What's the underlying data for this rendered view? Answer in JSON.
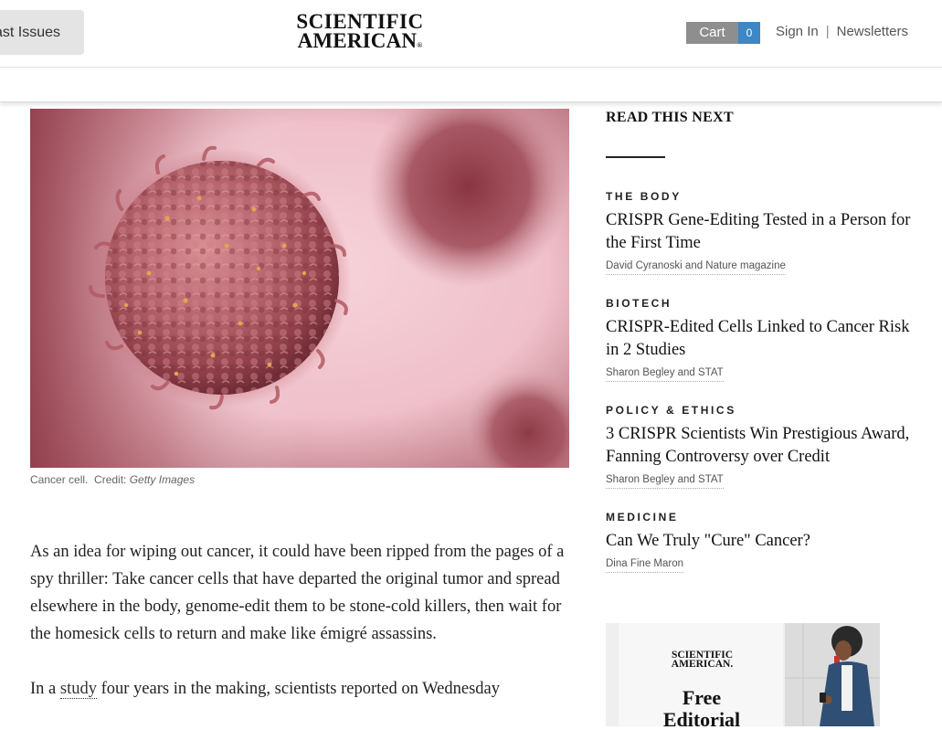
{
  "header": {
    "past_issues_label": "Past Issues",
    "logo_line1": "SCIENTIFIC",
    "logo_line2": "AMERICAN",
    "logo_mark": "®",
    "cart_label": "Cart",
    "cart_count": "0",
    "sign_in": "Sign In",
    "separator": "|",
    "newsletters": "Newsletters"
  },
  "article": {
    "image_caption": "Cancer cell.",
    "image_credit_label": "Credit:",
    "image_credit": "Getty Images",
    "paragraph1": "As an idea for wiping out cancer, it could have been ripped from the pages of a spy thriller: Take cancer cells that have departed the original tumor and spread elsewhere in the body, genome-edit them to be stone-cold killers, then wait for the homesick cells to return and make like émigré assassins.",
    "paragraph2_prefix": "In a",
    "paragraph2_link": "study",
    "paragraph2_rest": "four years in the making, scientists reported on Wednesday"
  },
  "sidebar": {
    "heading": "READ THIS NEXT",
    "items": [
      {
        "category": "THE BODY",
        "title": "CRISPR Gene-Editing Tested in a Person for the First Time",
        "author": "David Cyranoski and Nature magazine"
      },
      {
        "category": "BIOTECH",
        "title": "CRISPR-Edited Cells Linked to Cancer Risk in 2 Studies",
        "author": "Sharon Begley and STAT"
      },
      {
        "category": "POLICY & ETHICS",
        "title": "3 CRISPR Scientists Win Prestigious Award, Fanning Controversy over Credit",
        "author": "Sharon Begley and STAT"
      },
      {
        "category": "MEDICINE",
        "title": "Can We Truly \"Cure\" Cancer?",
        "author": "Dina Fine Maron"
      }
    ]
  },
  "ad": {
    "logo_line1": "SCIENTIFIC",
    "logo_line2": "AMERICAN.",
    "headline_line1": "Free",
    "headline_line2": "Editorial"
  },
  "colors": {
    "cart_badge": "#3d87c5",
    "cart_label_bg": "#8e8e8e",
    "past_issues_bg": "#e4e4e4"
  }
}
